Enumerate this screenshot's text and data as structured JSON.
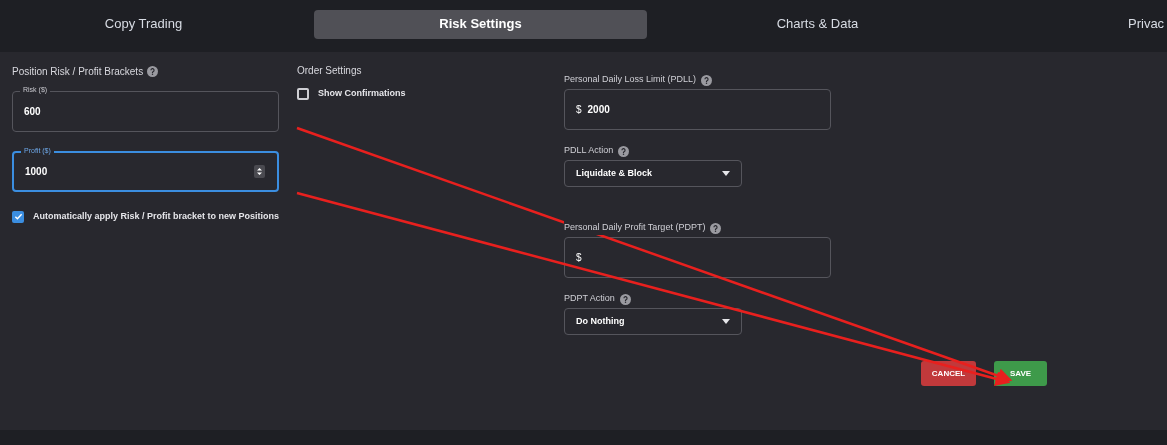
{
  "tabs": [
    {
      "label": "Copy Trading",
      "selected": false
    },
    {
      "label": "Risk Settings",
      "selected": true
    },
    {
      "label": "Charts & Data",
      "selected": false
    },
    {
      "label": "Privac",
      "selected": false
    }
  ],
  "brackets": {
    "title": "Position Risk / Profit Brackets",
    "fields": [
      {
        "label": "Risk ($)",
        "value": "600",
        "focused": false
      },
      {
        "label": "Profit ($)",
        "value": "1000",
        "focused": true
      }
    ],
    "auto_apply": {
      "label": "Automatically apply Risk / Profit bracket to new Positions",
      "checked": true
    }
  },
  "order_settings": {
    "title": "Order Settings",
    "options": [
      {
        "label": "Show Confirmations",
        "checked": false
      }
    ]
  },
  "limits": [
    {
      "kind": "money",
      "label": "Personal Daily Loss Limit (PDLL)",
      "prefix": "$",
      "value": "2000"
    },
    {
      "kind": "select",
      "label": "PDLL Action",
      "value": "Liquidate & Block"
    },
    {
      "kind": "money",
      "label": "Personal Daily Profit Target (PDPT)",
      "prefix": "$"
    },
    {
      "kind": "select",
      "label": "PDPT Action",
      "value": "Do Nothing"
    }
  ],
  "buttons": [
    {
      "label": "CANCEL",
      "kind": "cancel"
    },
    {
      "label": "SAVE",
      "kind": "save"
    }
  ]
}
